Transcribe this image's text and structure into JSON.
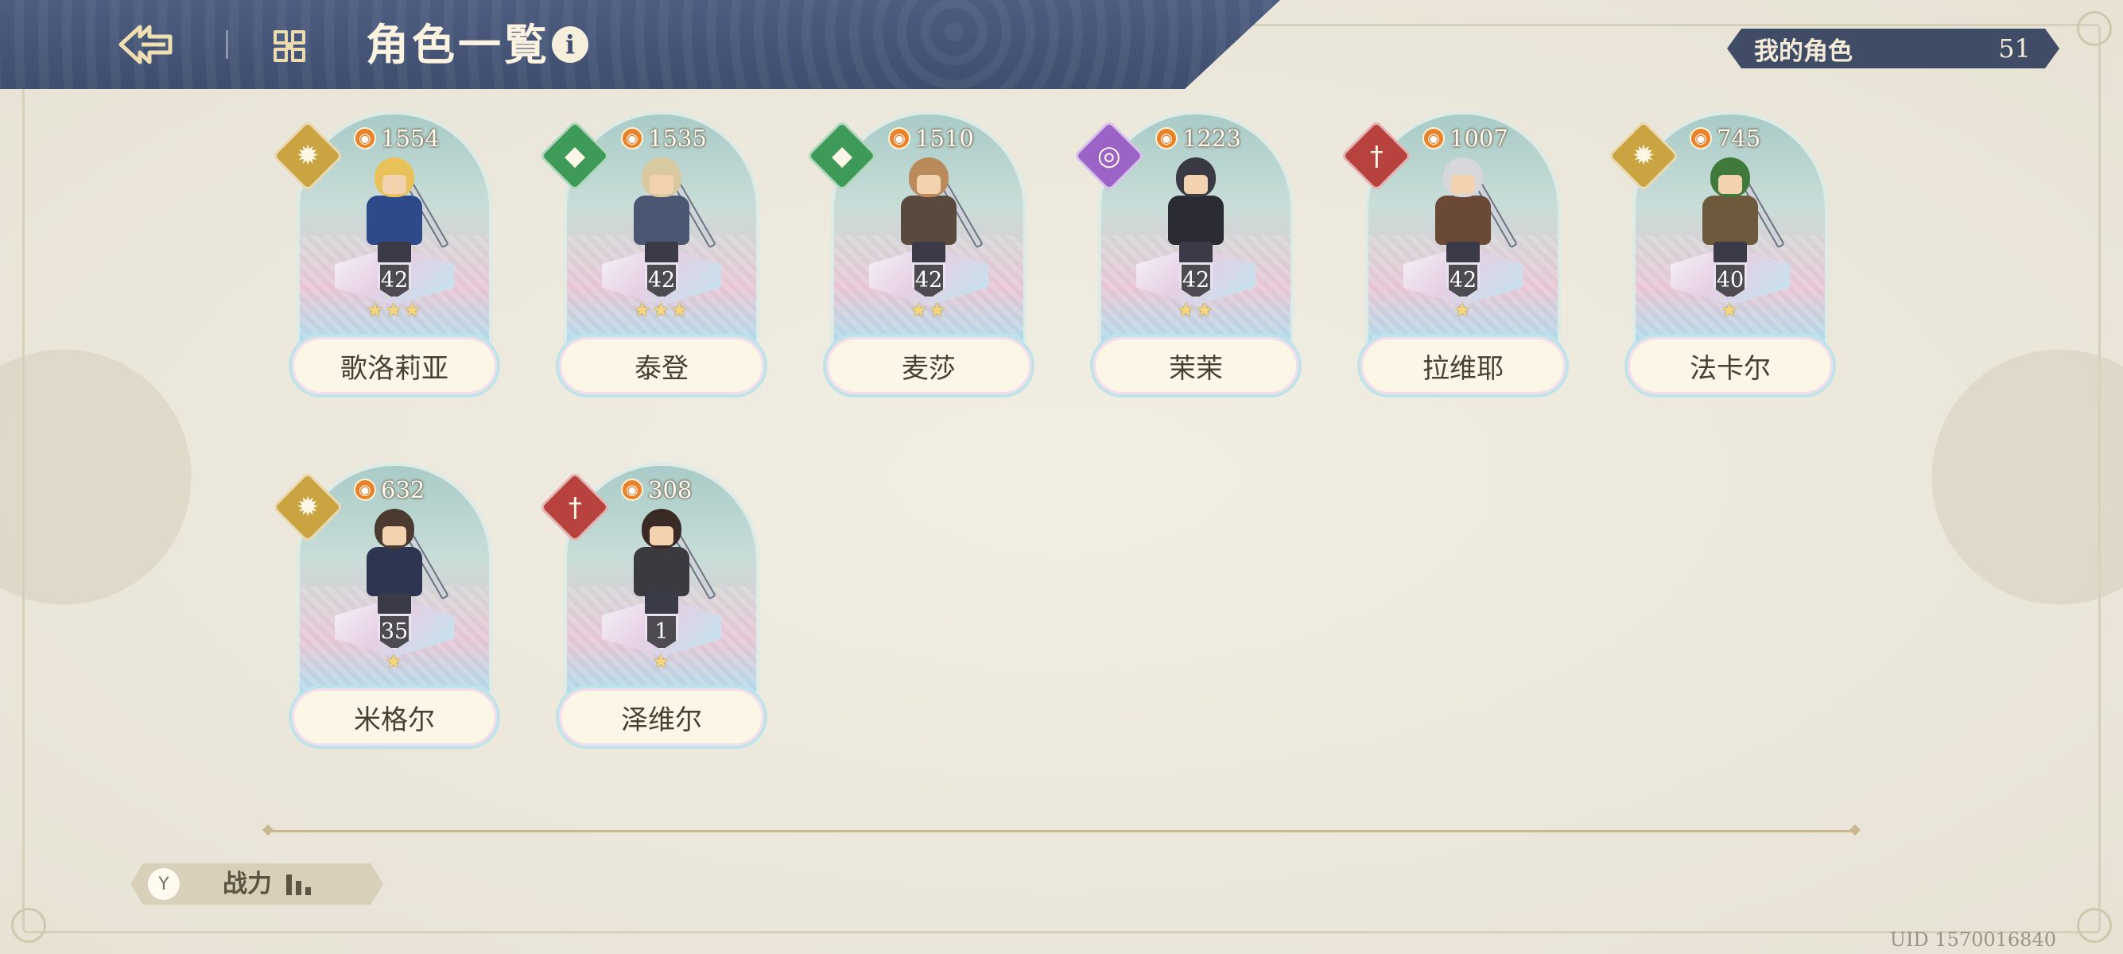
{
  "header": {
    "title": "角色一覧",
    "back_icon": "back-arrow-icon",
    "menu_icon": "grid-menu-icon",
    "info_icon": "info-icon",
    "info_glyph": "i"
  },
  "roster": {
    "label": "我的角色",
    "count": "51"
  },
  "characters": [
    {
      "name": "歌洛莉亚",
      "power": "1554",
      "level": "42",
      "stars": "★★★",
      "element": "sun",
      "element_glyph": "✹",
      "element_color": "#c9a441"
    },
    {
      "name": "泰登",
      "power": "1535",
      "level": "42",
      "stars": "★★★",
      "element": "shield",
      "element_glyph": "◆",
      "element_color": "#3d9a58"
    },
    {
      "name": "麦莎",
      "power": "1510",
      "level": "42",
      "stars": "★★",
      "element": "shield",
      "element_glyph": "◆",
      "element_color": "#3d9a58"
    },
    {
      "name": "茉茉",
      "power": "1223",
      "level": "42",
      "stars": "★★",
      "element": "arcane",
      "element_glyph": "◎",
      "element_color": "#9c63c7"
    },
    {
      "name": "拉维耶",
      "power": "1007",
      "level": "42",
      "stars": "★",
      "element": "sword",
      "element_glyph": "†",
      "element_color": "#b8433e"
    },
    {
      "name": "法卡尔",
      "power": "745",
      "level": "40",
      "stars": "★",
      "element": "sun",
      "element_glyph": "✹",
      "element_color": "#c9a441"
    },
    {
      "name": "米格尔",
      "power": "632",
      "level": "35",
      "stars": "★",
      "element": "sun",
      "element_glyph": "✹",
      "element_color": "#c9a441"
    },
    {
      "name": "泽维尔",
      "power": "308",
      "level": "1",
      "stars": "★",
      "element": "sword",
      "element_glyph": "†",
      "element_color": "#b8433e"
    }
  ],
  "sort": {
    "label": "战力",
    "icon": "filter-icon",
    "icon_glyph": "Y"
  },
  "uid": "UID 1570016840",
  "flame_glyph": "◉"
}
